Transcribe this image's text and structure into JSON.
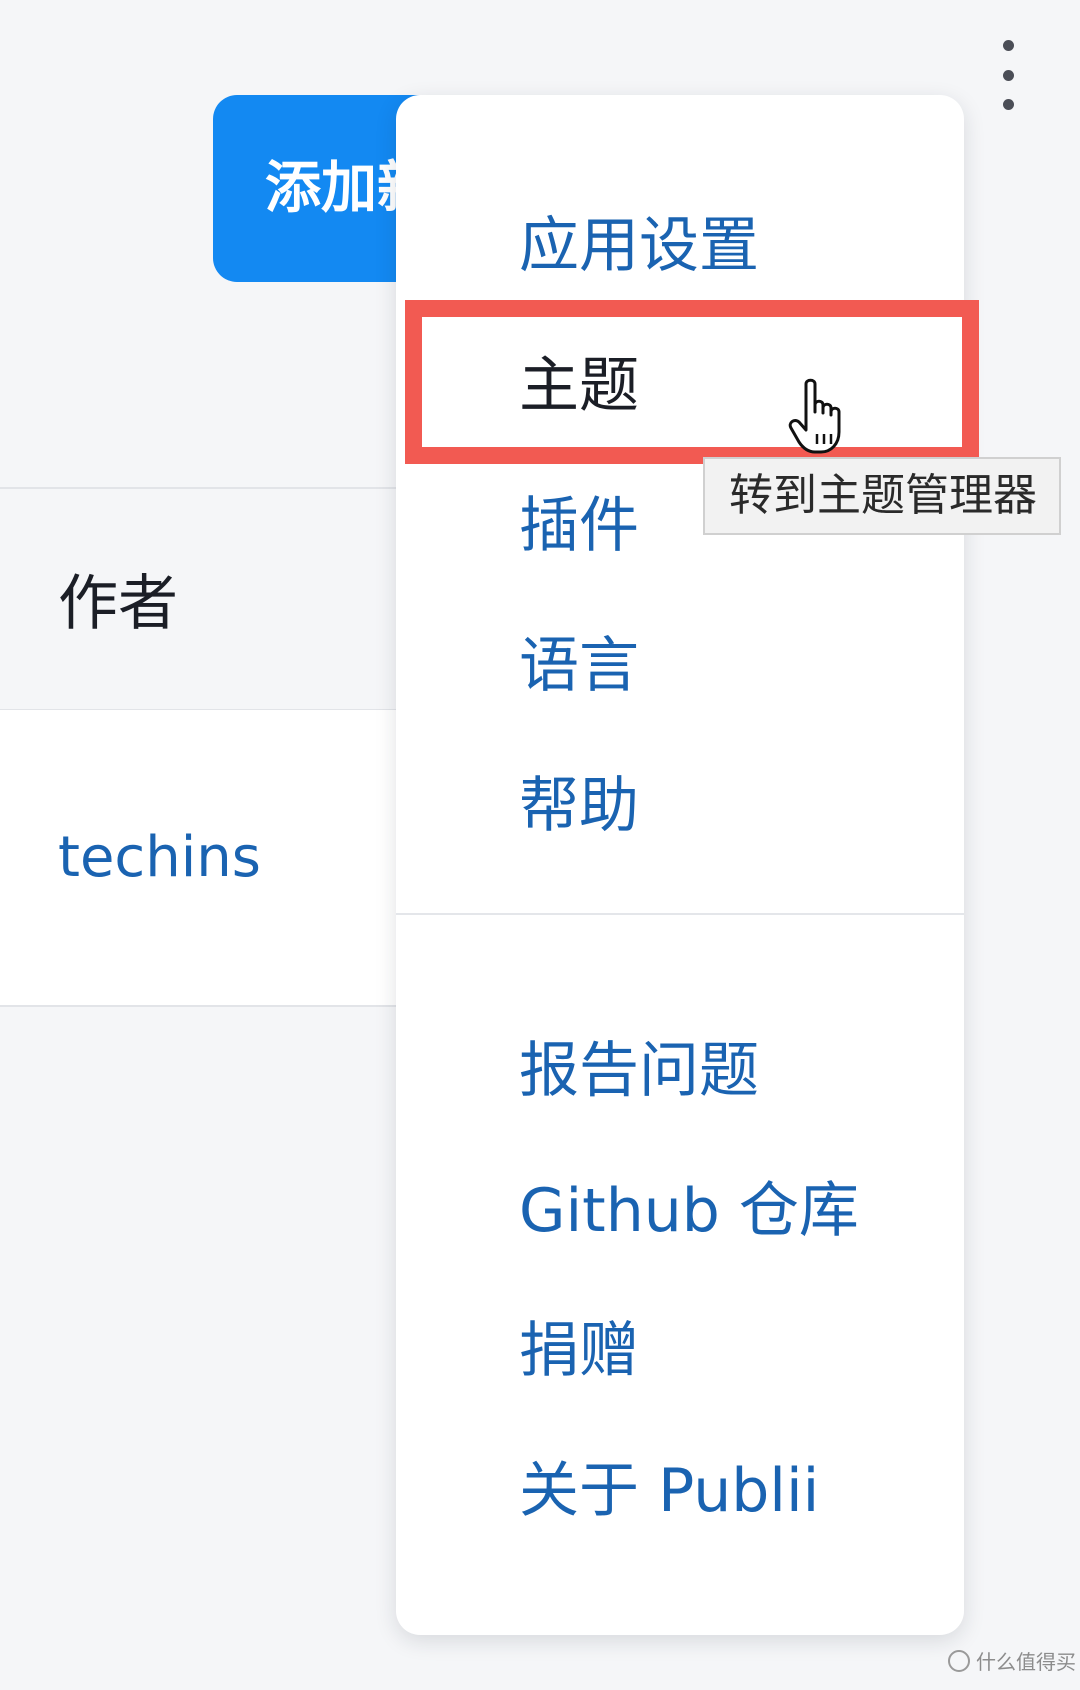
{
  "header": {
    "more_icon": "more-vertical-icon"
  },
  "toolbar": {
    "add_new_label": "添加新"
  },
  "table": {
    "column_header": "作者",
    "rows": [
      {
        "author": "techins"
      }
    ]
  },
  "menu": {
    "group_primary": [
      {
        "label": "应用设置"
      },
      {
        "label": "主题"
      },
      {
        "label": "插件"
      },
      {
        "label": "语言"
      },
      {
        "label": "帮助"
      }
    ],
    "group_secondary": [
      {
        "label": "报告问题"
      },
      {
        "label": "Github 仓库"
      },
      {
        "label": "捐赠"
      },
      {
        "label": "关于 Publii"
      }
    ]
  },
  "tooltip": {
    "text": "转到主题管理器"
  },
  "annotation": {
    "highlight_color": "#f25a52"
  },
  "cursor": {
    "icon": "hand-pointer-icon"
  },
  "watermark": {
    "text": "什么值得买"
  },
  "colors": {
    "accent": "#1389f2",
    "link": "#1a63b1",
    "text": "#1b1e26"
  }
}
